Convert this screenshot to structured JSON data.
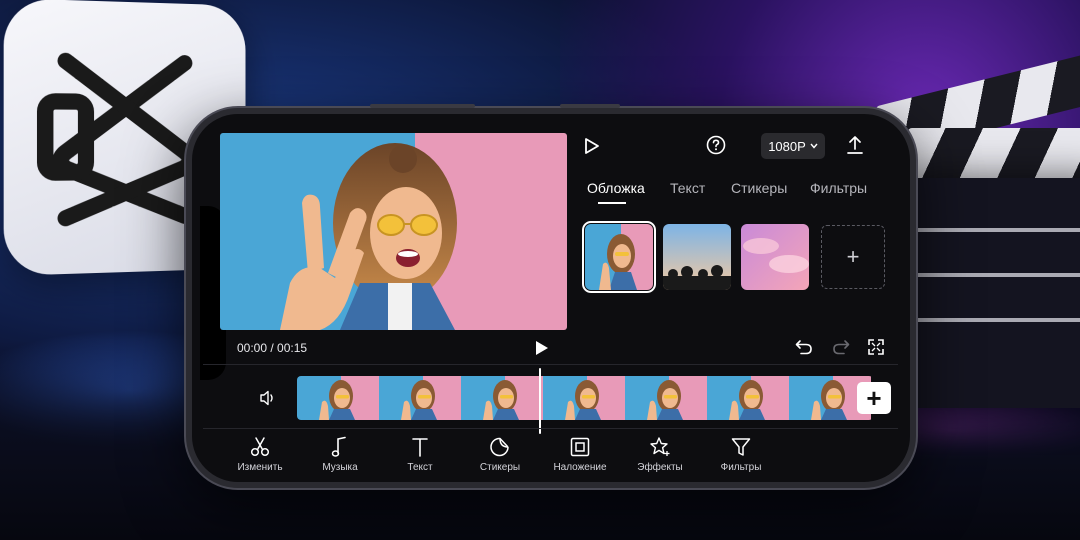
{
  "app": {
    "brand_colors": {
      "accent": "#ffffff",
      "panel": "#0d0d10",
      "button_bg": "#2a2a2e"
    }
  },
  "header": {
    "resolution_label": "1080P",
    "icons": [
      "play-outline-icon",
      "help-icon",
      "export-icon"
    ]
  },
  "cover_panel": {
    "tabs": [
      {
        "label": "Обложка",
        "active": true
      },
      {
        "label": "Текст",
        "active": false
      },
      {
        "label": "Стикеры",
        "active": false
      },
      {
        "label": "Фильтры",
        "active": false
      }
    ],
    "thumbnails": [
      {
        "kind": "frame-selfie",
        "selected": true
      },
      {
        "kind": "palm-sky",
        "selected": false
      },
      {
        "kind": "pink-clouds",
        "selected": false
      }
    ],
    "add_label": "+"
  },
  "playback": {
    "time_label": "00:00 / 00:15",
    "icons": [
      "play-icon",
      "undo-icon",
      "redo-icon",
      "fullscreen-icon"
    ]
  },
  "timeline": {
    "frame_count": 7,
    "add_clip_label": "+",
    "icons": [
      "audio-mute-icon"
    ]
  },
  "toolbar": {
    "items": [
      {
        "label": "Изменить",
        "icon": "scissors-icon"
      },
      {
        "label": "Музыка",
        "icon": "music-note-icon"
      },
      {
        "label": "Текст",
        "icon": "text-icon"
      },
      {
        "label": "Стикеры",
        "icon": "sticker-icon"
      },
      {
        "label": "Наложение",
        "icon": "overlay-icon"
      },
      {
        "label": "Эффекты",
        "icon": "effects-star-icon"
      },
      {
        "label": "Фильтры",
        "icon": "filter-icon"
      }
    ]
  }
}
